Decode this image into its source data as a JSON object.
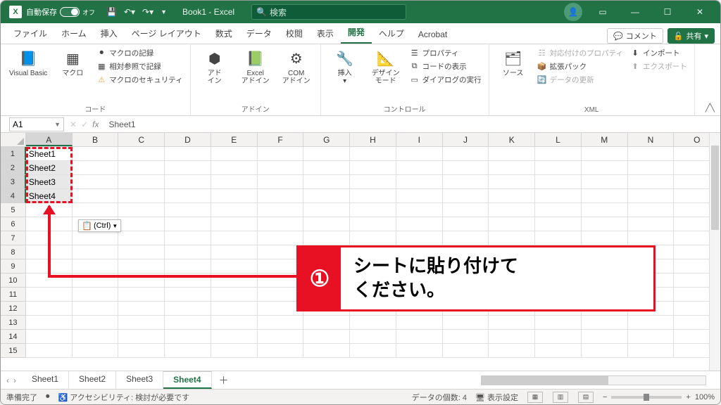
{
  "titlebar": {
    "autosave_label": "自動保存",
    "autosave_state": "オフ",
    "title": "Book1 - Excel",
    "search_placeholder": "検索"
  },
  "tabs": {
    "items": [
      "ファイル",
      "ホーム",
      "挿入",
      "ページ レイアウト",
      "数式",
      "データ",
      "校閲",
      "表示",
      "開発",
      "ヘルプ",
      "Acrobat"
    ],
    "active": 8,
    "comment_btn": "コメント",
    "share_btn": "共有"
  },
  "ribbon": {
    "g0": {
      "vb": "Visual Basic",
      "macro": "マクロ",
      "rec": "マクロの記録",
      "relref": "相対参照で記録",
      "sec": "マクロのセキュリティ",
      "label": "コード"
    },
    "g1": {
      "addin": "アド\nイン",
      "excel": "Excel\nアドイン",
      "com": "COM\nアドイン",
      "label": "アドイン"
    },
    "g2": {
      "insert": "挿入",
      "design": "デザイン\nモード",
      "prop": "プロパティ",
      "code": "コードの表示",
      "dialog": "ダイアログの実行",
      "label": "コントロール"
    },
    "g3": {
      "source": "ソース",
      "mapprop": "対応付けのプロパティ",
      "expand": "拡張パック",
      "refresh": "データの更新",
      "import": "インポート",
      "export": "エクスポート",
      "label": "XML"
    }
  },
  "formula": {
    "ref": "A1",
    "value": "Sheet1"
  },
  "grid": {
    "cols": [
      "A",
      "B",
      "C",
      "D",
      "E",
      "F",
      "G",
      "H",
      "I",
      "J",
      "K",
      "L",
      "M",
      "N",
      "O"
    ],
    "rows": 15,
    "cells": {
      "A1": "Sheet1",
      "A2": "Sheet2",
      "A3": "Sheet3",
      "A4": "Sheet4"
    },
    "sel_col": 0,
    "sel_rows": [
      1,
      2,
      3,
      4
    ]
  },
  "paste_opt": "(Ctrl)",
  "annotation": {
    "num": "①",
    "text": "シートに貼り付けて\nください。"
  },
  "sheets": {
    "items": [
      "Sheet1",
      "Sheet2",
      "Sheet3",
      "Sheet4"
    ],
    "active": 3
  },
  "status": {
    "ready": "準備完了",
    "acc": "アクセシビリティ: 検討が必要です",
    "count": "データの個数: 4",
    "display": "表示設定",
    "zoom": "100%"
  }
}
